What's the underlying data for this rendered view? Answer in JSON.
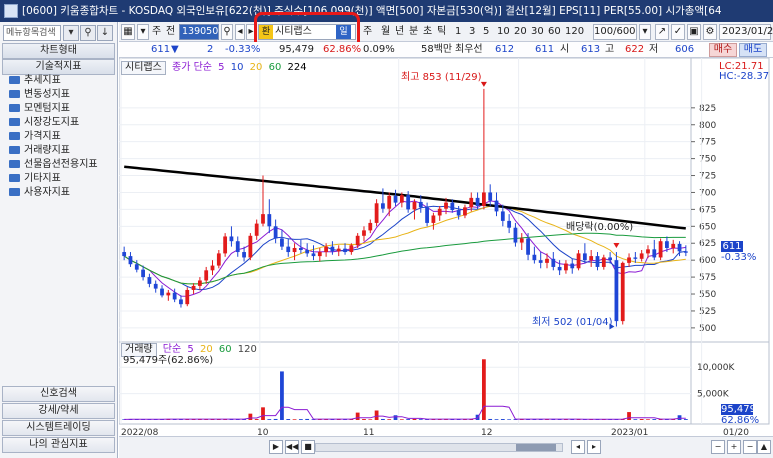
{
  "window": {
    "title": "[0600] 키움종합차트 - KOSDAQ 외국인보유[622(천)] 주식수[106,099(천)] 액면[500] 자본금[530(억)] 결산[12월] EPS[11] PER[55.00] 시가총액[64"
  },
  "sidebar": {
    "search_placeholder": "메뉴항목검색",
    "chart_type_label": "차트형태",
    "indicator_header": "기술적지표",
    "tree_items": [
      "추세지표",
      "변동성지표",
      "모멘텀지표",
      "시장강도지표",
      "가격지표",
      "거래량지표",
      "선물옵션전용지표",
      "기타지표",
      "사용자지표"
    ],
    "bottom_items": [
      "신호검색",
      "강세/약세",
      "시스템트레이딩",
      "나의 관심지표"
    ]
  },
  "toolbar": {
    "period_label": "주",
    "period_label_2": "전",
    "stock_code": "139050",
    "stock_name": "시티랩스",
    "hwan_badge": "환",
    "mode_badge": "일",
    "period_buttons": [
      "주",
      "월",
      "년",
      "분",
      "초",
      "틱"
    ],
    "interval_buttons": [
      "1",
      "3",
      "5",
      "10",
      "20",
      "30",
      "60",
      "120"
    ],
    "count_value": "100/600",
    "date_value": "2023/01/20"
  },
  "pricebar": {
    "price": "611",
    "change_symbol": "▼",
    "change": "2",
    "change_pct": "-0.33%",
    "volume": "95,479",
    "volume_pct": "62.86%",
    "turnover_pct": "0.09%",
    "amount": "58백만",
    "priority_label": "최우선",
    "bid1": "612",
    "bid2": "611",
    "open_label": "시",
    "open": "613",
    "high_label": "고",
    "high": "622",
    "low_label": "저",
    "low": "606",
    "buy_label": "매수",
    "sell_label": "매도"
  },
  "chart_data": {
    "type": "candlestick",
    "price_panel": {
      "legend_name": "시티랩스",
      "ma_label": "종가 단순",
      "ma_periods": [
        "5",
        "10",
        "20",
        "60",
        "224"
      ],
      "ma_colors": [
        "#8b1bd3",
        "#1c44c9",
        "#e8b418",
        "#1a9b3e",
        "#000000"
      ],
      "y_axis_ticks": [
        825,
        800,
        775,
        750,
        725,
        700,
        675,
        650,
        625,
        600,
        575,
        550,
        525,
        500
      ],
      "ylim": [
        488,
        872
      ],
      "high_annotation": "최고 853 (11/29)",
      "low_annotation": "최저 502 (01/04)",
      "dividend_annotation": "배당락(0.00%)",
      "lc_label": "LC:21.71",
      "hc_label": "HC:-28.37",
      "current_price_tag": "611",
      "current_pct_tag": "-0.33%",
      "ohlc": [
        [
          612,
          620,
          600,
          606
        ],
        [
          606,
          612,
          590,
          594
        ],
        [
          594,
          600,
          582,
          586
        ],
        [
          586,
          592,
          570,
          575
        ],
        [
          575,
          580,
          560,
          565
        ],
        [
          565,
          570,
          552,
          558
        ],
        [
          558,
          563,
          545,
          548
        ],
        [
          548,
          556,
          540,
          552
        ],
        [
          552,
          558,
          538,
          542
        ],
        [
          542,
          548,
          530,
          535
        ],
        [
          535,
          560,
          532,
          556
        ],
        [
          556,
          566,
          550,
          562
        ],
        [
          562,
          575,
          556,
          570
        ],
        [
          570,
          590,
          565,
          585
        ],
        [
          585,
          600,
          578,
          592
        ],
        [
          592,
          615,
          588,
          610
        ],
        [
          610,
          640,
          605,
          635
        ],
        [
          635,
          650,
          620,
          628
        ],
        [
          628,
          635,
          605,
          612
        ],
        [
          612,
          620,
          598,
          604
        ],
        [
          604,
          640,
          600,
          636
        ],
        [
          636,
          660,
          630,
          654
        ],
        [
          654,
          725,
          650,
          668
        ],
        [
          668,
          690,
          640,
          650
        ],
        [
          650,
          660,
          625,
          632
        ],
        [
          632,
          645,
          615,
          620
        ],
        [
          620,
          632,
          605,
          612
        ],
        [
          612,
          625,
          600,
          618
        ],
        [
          618,
          630,
          610,
          615
        ],
        [
          615,
          625,
          605,
          610
        ],
        [
          610,
          622,
          600,
          606
        ],
        [
          606,
          618,
          598,
          612
        ],
        [
          612,
          625,
          605,
          620
        ],
        [
          620,
          628,
          608,
          613
        ],
        [
          613,
          622,
          606,
          617
        ],
        [
          617,
          625,
          608,
          612
        ],
        [
          612,
          625,
          608,
          622
        ],
        [
          622,
          640,
          618,
          636
        ],
        [
          636,
          650,
          628,
          644
        ],
        [
          644,
          660,
          640,
          655
        ],
        [
          655,
          690,
          650,
          684
        ],
        [
          684,
          706,
          670,
          676
        ],
        [
          676,
          700,
          665,
          695
        ],
        [
          695,
          704,
          680,
          685
        ],
        [
          685,
          700,
          678,
          696
        ],
        [
          696,
          702,
          670,
          675
        ],
        [
          675,
          690,
          660,
          686
        ],
        [
          686,
          696,
          670,
          678
        ],
        [
          678,
          685,
          650,
          655
        ],
        [
          655,
          670,
          645,
          666
        ],
        [
          666,
          680,
          658,
          676
        ],
        [
          676,
          692,
          668,
          685
        ],
        [
          685,
          690,
          670,
          674
        ],
        [
          674,
          680,
          660,
          666
        ],
        [
          666,
          682,
          662,
          678
        ],
        [
          678,
          700,
          672,
          692
        ],
        [
          692,
          700,
          675,
          680
        ],
        [
          680,
          853,
          675,
          700
        ],
        [
          700,
          712,
          680,
          688
        ],
        [
          688,
          700,
          665,
          672
        ],
        [
          672,
          682,
          650,
          658
        ],
        [
          658,
          668,
          640,
          648
        ],
        [
          648,
          655,
          620,
          626
        ],
        [
          626,
          640,
          615,
          632
        ],
        [
          632,
          640,
          600,
          608
        ],
        [
          608,
          620,
          595,
          600
        ],
        [
          600,
          612,
          588,
          596
        ],
        [
          596,
          610,
          588,
          602
        ],
        [
          602,
          612,
          585,
          590
        ],
        [
          590,
          600,
          578,
          585
        ],
        [
          585,
          600,
          580,
          595
        ],
        [
          595,
          602,
          580,
          588
        ],
        [
          588,
          615,
          585,
          610
        ],
        [
          610,
          625,
          595,
          600
        ],
        [
          600,
          615,
          590,
          606
        ],
        [
          606,
          612,
          585,
          590
        ],
        [
          590,
          608,
          586,
          604
        ],
        [
          604,
          612,
          595,
          600
        ],
        [
          600,
          612,
          502,
          510
        ],
        [
          510,
          598,
          505,
          596
        ],
        [
          596,
          610,
          590,
          604
        ],
        [
          604,
          612,
          596,
          602
        ],
        [
          602,
          615,
          598,
          610
        ],
        [
          610,
          622,
          603,
          616
        ],
        [
          616,
          630,
          600,
          604
        ],
        [
          604,
          632,
          600,
          628
        ],
        [
          628,
          635,
          612,
          618
        ],
        [
          618,
          630,
          610,
          624
        ],
        [
          624,
          628,
          606,
          613
        ],
        [
          613,
          622,
          606,
          611
        ]
      ]
    },
    "volume_panel": {
      "legend_name": "거래량",
      "ma_label": "단순",
      "ma_periods": [
        "5",
        "20",
        "60",
        "120"
      ],
      "current_text": "95,479주(62.86%)",
      "y_axis_ticks": [
        "10,000K",
        "5,000K"
      ],
      "volume_tag": "95,479",
      "pct_tag": "62.86%",
      "spike_volumes_k": [
        {
          "index": 25,
          "value": 9200
        },
        {
          "index": 20,
          "value": 1200
        },
        {
          "index": 22,
          "value": 2400
        },
        {
          "index": 37,
          "value": 1400
        },
        {
          "index": 40,
          "value": 1800
        },
        {
          "index": 43,
          "value": 900
        },
        {
          "index": 57,
          "value": 11500
        },
        {
          "index": 56,
          "value": 1000
        },
        {
          "index": 80,
          "value": 1500
        },
        {
          "index": 88,
          "value": 900
        }
      ]
    },
    "x_axis_labels": [
      "2022/08",
      "10",
      "11",
      "12",
      "2023/01",
      "01/20"
    ]
  },
  "bottombar": {
    "nav_icons": [
      "play",
      "back",
      "stop",
      "fast-forward"
    ]
  }
}
